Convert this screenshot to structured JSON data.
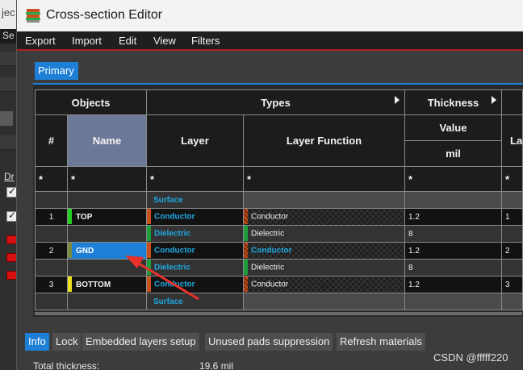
{
  "background_app": {
    "title_fragment": "jec",
    "menu_fragment": "Se",
    "label_fragment": "Dr"
  },
  "window": {
    "title": "Cross-section Editor",
    "icon": "layer-stack-icon"
  },
  "menu": {
    "items": [
      "Export",
      "Import",
      "Edit",
      "View",
      "Filters"
    ]
  },
  "tabs": {
    "primary": "Primary"
  },
  "grid": {
    "group_headers": {
      "objects": "Objects",
      "types": "Types",
      "thickness": "Thickness"
    },
    "column_headers": {
      "num": "#",
      "name": "Name",
      "layer": "Layer",
      "layer_function": "Layer Function",
      "value": "Value",
      "unit": "mil",
      "last_fragment": "La"
    },
    "filter_symbol": "*",
    "rows": [
      {
        "num": "",
        "name": "",
        "layer": "Surface",
        "function": "",
        "thickness": "",
        "last": "",
        "layer_color": "",
        "name_color": ""
      },
      {
        "num": "1",
        "name": "TOP",
        "layer": "Conductor",
        "function": "Conductor",
        "thickness": "1.2",
        "last": "1",
        "layer_color": "#c8501e",
        "name_color": "#22d022"
      },
      {
        "num": "",
        "name": "",
        "layer": "Dielectric",
        "function": "Dielectric",
        "thickness": "8",
        "last": "",
        "layer_color": "#1e9e3a",
        "name_color": ""
      },
      {
        "num": "2",
        "name": "GND",
        "layer": "Conductor",
        "function": "Conductor",
        "thickness": "1.2",
        "last": "2",
        "layer_color": "#c8501e",
        "name_color": "#7a8a3a"
      },
      {
        "num": "",
        "name": "",
        "layer": "Dielectric",
        "function": "Dielectric",
        "thickness": "8",
        "last": "",
        "layer_color": "#1e9e3a",
        "name_color": ""
      },
      {
        "num": "3",
        "name": "BOTTOM",
        "layer": "Conductor",
        "function": "Conductor",
        "thickness": "1.2",
        "last": "3",
        "layer_color": "#c8501e",
        "name_color": "#e8e020"
      },
      {
        "num": "",
        "name": "",
        "layer": "Surface",
        "function": "",
        "thickness": "",
        "last": "",
        "layer_color": "",
        "name_color": ""
      }
    ]
  },
  "bottom_tabs": [
    "Info",
    "Lock",
    "Embedded layers setup",
    "Unused pads suppression",
    "Refresh materials"
  ],
  "info": {
    "total_thickness_label": "Total thickness:",
    "total_thickness_value": "19.6 mil"
  },
  "watermark": "CSDN @fffff220",
  "colors": {
    "accent": "#1e7fd6",
    "menu_underline": "#b31d1d",
    "layer_text": "#1fa8e0",
    "annotation_arrow": "#e8312a"
  }
}
